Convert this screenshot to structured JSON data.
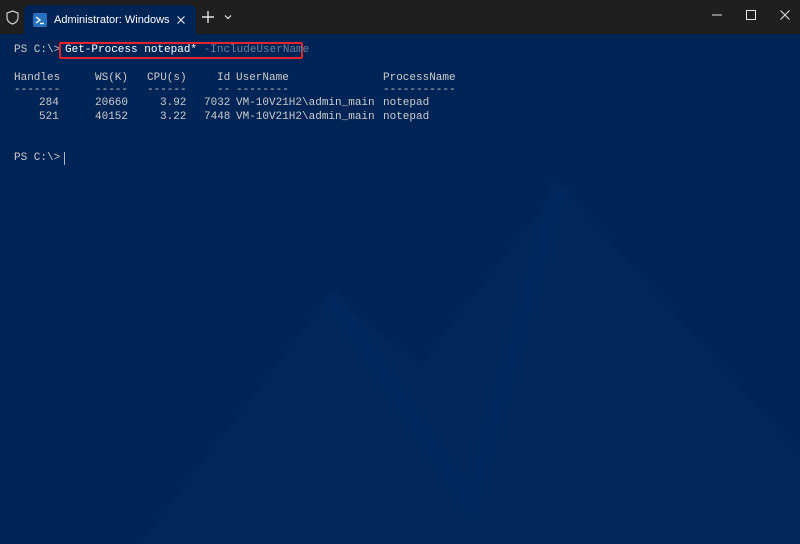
{
  "titlebar": {
    "tab_title": "Administrator: Windows PowerShell",
    "accent": "#012456",
    "icons": [
      "shield-icon",
      "powershell-icon",
      "close-icon",
      "plus-icon",
      "chevron-down-icon",
      "minimize-icon",
      "maximize-icon",
      "close-icon"
    ]
  },
  "terminal": {
    "prompt": "PS C:\\>",
    "command": "Get-Process notepad*",
    "parameter": "-IncludeUserName",
    "columns": [
      "Handles",
      "WS(K)",
      "CPU(s)",
      "Id",
      "UserName",
      "ProcessName"
    ],
    "dashes": [
      "-------",
      "-----",
      "------",
      "--",
      "--------",
      "-----------"
    ],
    "rows": [
      [
        "284",
        "20660",
        "3.92",
        "7032",
        "VM-10V21H2\\admin_main",
        "notepad"
      ],
      [
        "521",
        "40152",
        "3.22",
        "7448",
        "VM-10V21H2\\admin_main",
        "notepad"
      ]
    ],
    "prompt2": "PS C:\\>"
  }
}
